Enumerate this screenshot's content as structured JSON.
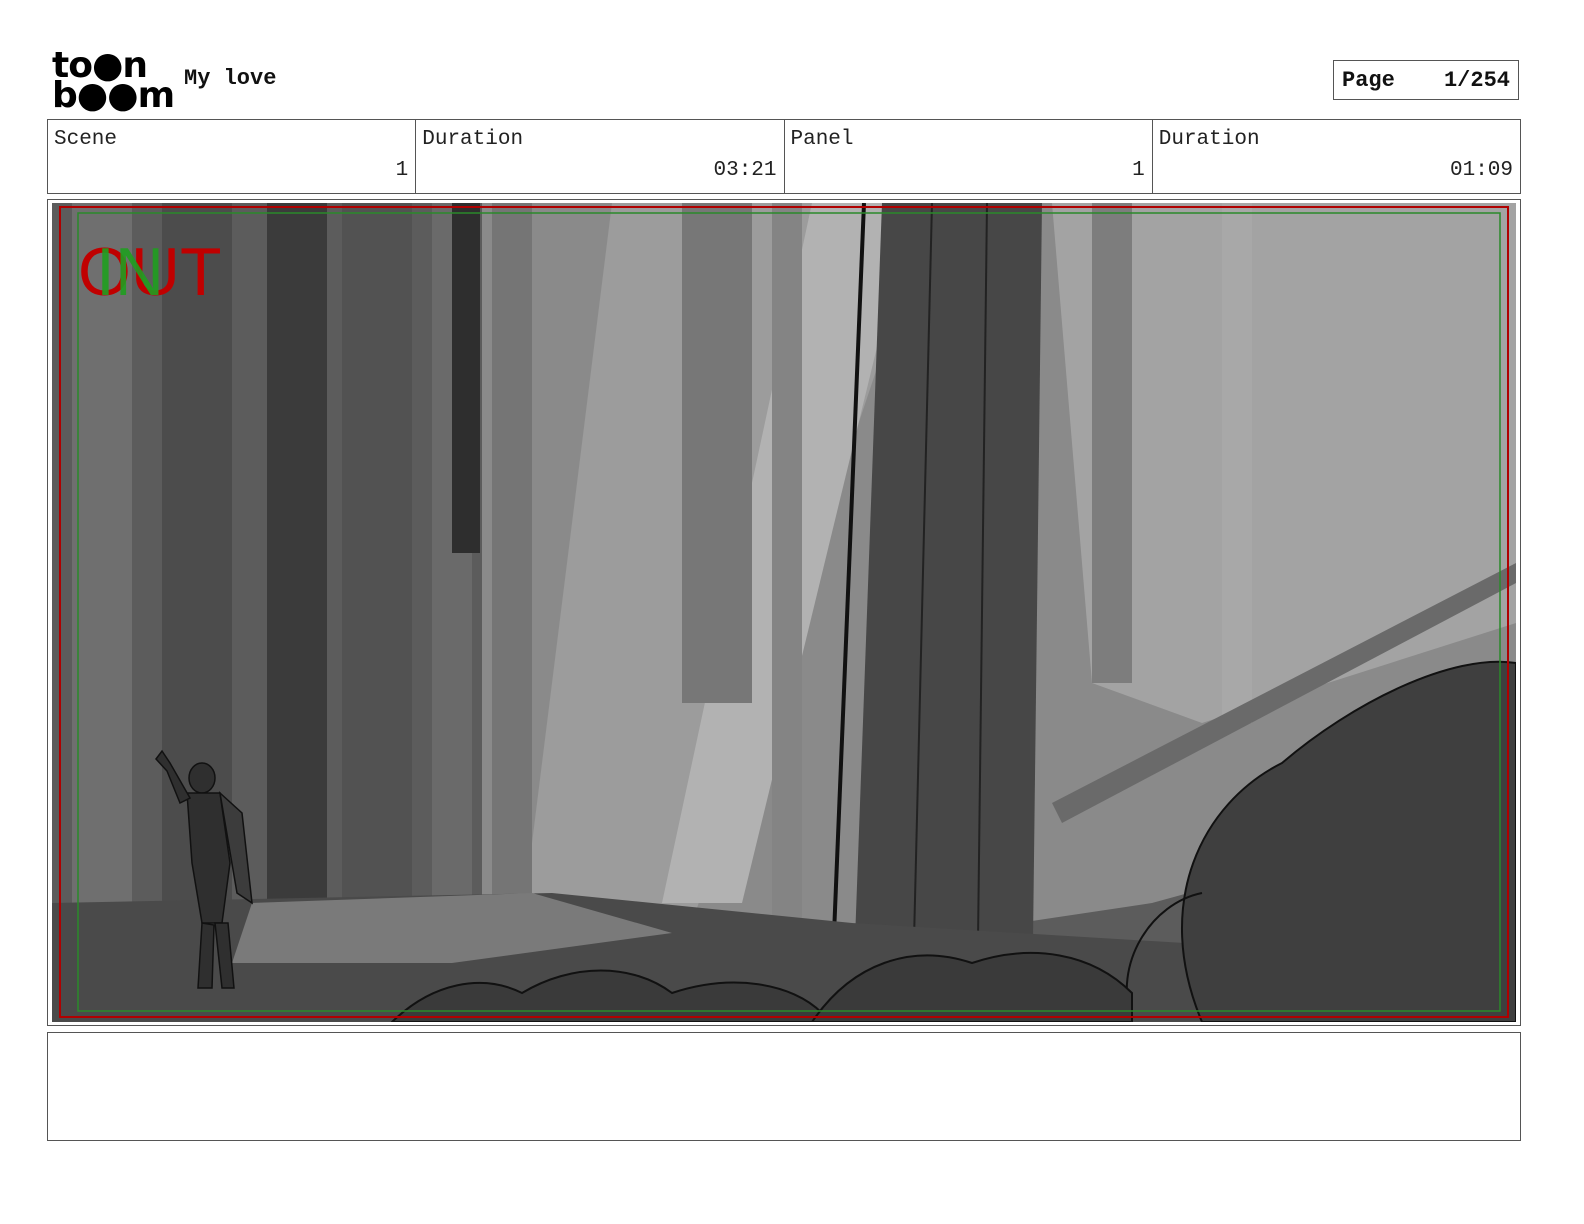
{
  "header": {
    "logo_line1": "to●n",
    "logo_line2": "b●●m",
    "project_title": "My love",
    "page_label": "Page",
    "page_value": "1/254"
  },
  "info": {
    "scene_label": "Scene",
    "scene_value": "1",
    "scene_duration_label": "Duration",
    "scene_duration_value": "03:21",
    "panel_label": "Panel",
    "panel_value": "1",
    "panel_duration_label": "Duration",
    "panel_duration_value": "01:09"
  },
  "panel": {
    "out_marker": "OUT",
    "in_marker": "IN",
    "out_color": "#c00000",
    "in_color": "#1f9e1f"
  },
  "notes": {
    "text": ""
  }
}
